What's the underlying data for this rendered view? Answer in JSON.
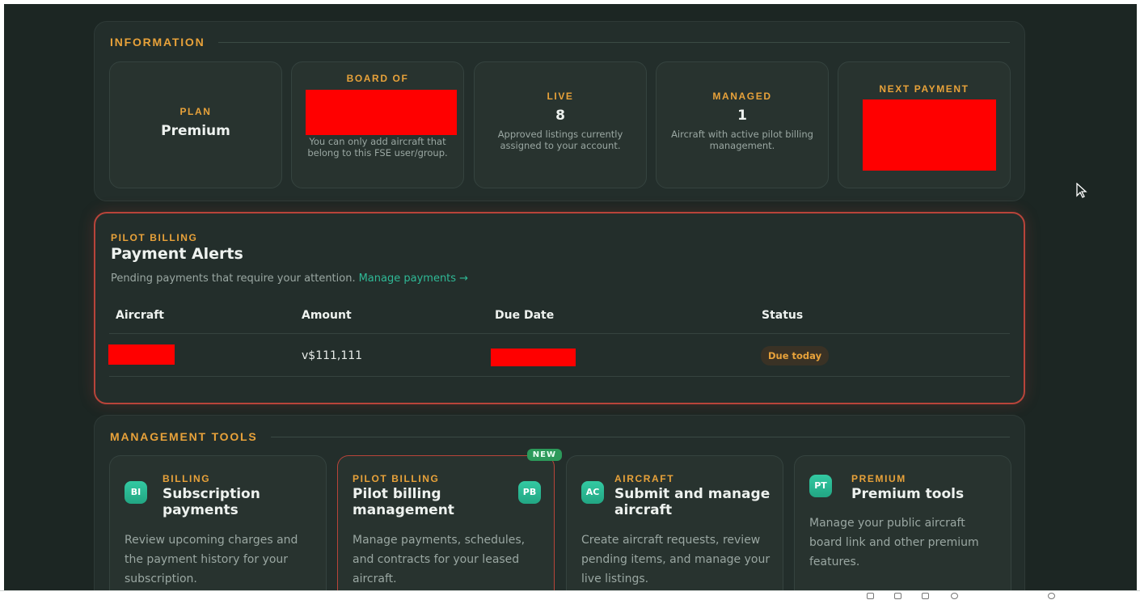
{
  "information": {
    "section_title": "INFORMATION",
    "plan": {
      "label": "PLAN",
      "value": "Premium"
    },
    "board": {
      "label": "BOARD OF",
      "desc": "You can only add aircraft that belong to this FSE user/group."
    },
    "live": {
      "label": "LIVE",
      "value": "8",
      "desc": "Approved listings currently assigned to your account."
    },
    "managed": {
      "label": "MANAGED",
      "value": "1",
      "desc": "Aircraft with active pilot billing management."
    },
    "next_payment": {
      "label": "NEXT PAYMENT"
    }
  },
  "alerts": {
    "eyebrow": "PILOT BILLING",
    "title": "Payment Alerts",
    "desc": "Pending payments that require your attention.",
    "link": "Manage payments →",
    "columns": [
      "Aircraft",
      "Amount",
      "Due Date",
      "Status"
    ],
    "row": {
      "amount": "v$111,111",
      "status": "Due today"
    }
  },
  "tools": {
    "section_title": "MANAGEMENT TOOLS",
    "cards": [
      {
        "badge": "BI",
        "eyebrow": "BILLING",
        "title": "Subscription payments",
        "desc": "Review upcoming charges and the payment history for your subscription."
      },
      {
        "badge": "PB",
        "eyebrow": "PILOT BILLING",
        "title": "Pilot billing management",
        "desc": "Manage payments, schedules, and contracts for your leased aircraft.",
        "tag": "NEW"
      },
      {
        "badge": "AC",
        "eyebrow": "AIRCRAFT",
        "title": "Submit and manage aircraft",
        "desc": "Create aircraft requests, review pending items, and manage your live listings."
      },
      {
        "badge": "PT",
        "eyebrow": "PREMIUM",
        "title": "Premium tools",
        "desc": "Manage your public aircraft board link and other premium features."
      }
    ]
  },
  "colors": {
    "accent": "#e8a23a",
    "teal": "#2fb996",
    "alert_border": "#b8443a",
    "redaction": "#ff0000"
  }
}
